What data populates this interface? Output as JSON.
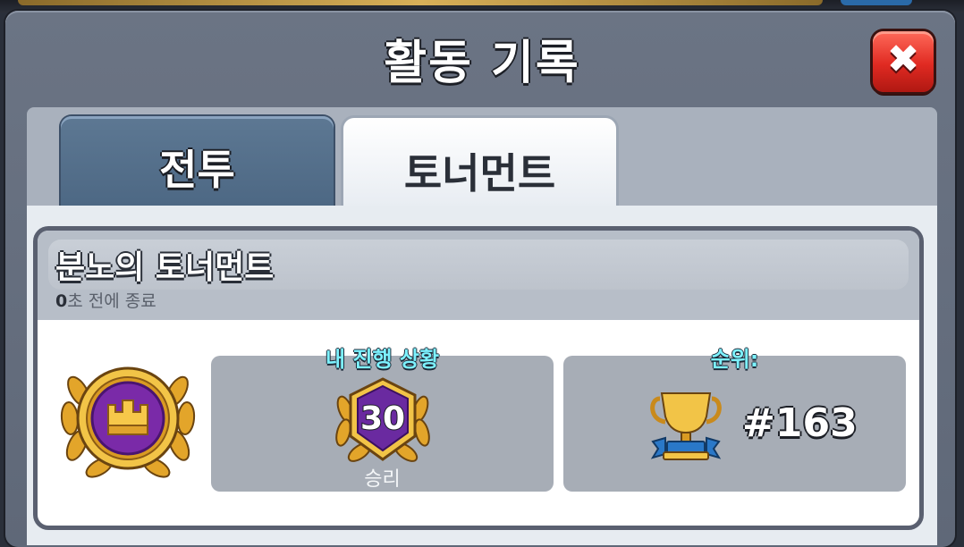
{
  "window": {
    "title": "활동 기록",
    "close_icon": "close-x-icon"
  },
  "tabs": [
    {
      "label": "전투",
      "active": false
    },
    {
      "label": "토너먼트",
      "active": true
    }
  ],
  "event": {
    "name": "분노의 토너먼트",
    "time_number": "0",
    "time_suffix": "초 전에 종료",
    "emblem_icon": "crown-laurel-emblem-icon"
  },
  "progress": {
    "label": "내 진행 상황",
    "wins": "30",
    "wins_label": "승리",
    "badge_icon": "laurel-badge-icon"
  },
  "rank": {
    "label": "순위:",
    "value": "#163",
    "trophy_icon": "trophy-icon"
  },
  "colors": {
    "accent_label": "#7df2ff",
    "close_red": "#e02a22",
    "gold": "#f0c040",
    "purple": "#7a2aa8"
  }
}
